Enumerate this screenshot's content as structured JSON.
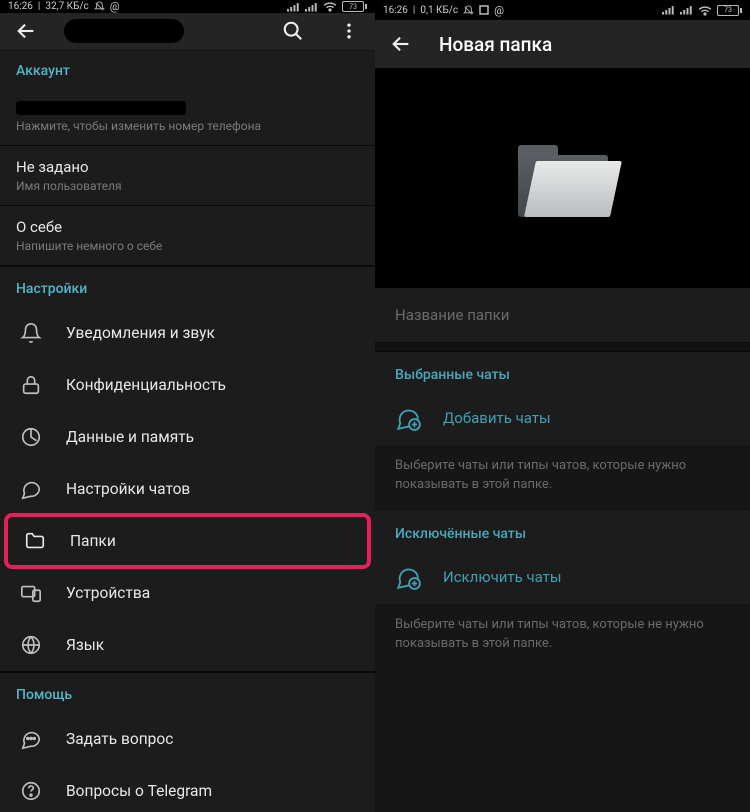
{
  "left": {
    "status": {
      "time": "16:26",
      "net": "32,7 КБ/с",
      "battery": "73"
    },
    "account": {
      "header": "Аккаунт",
      "phone_hint": "Нажмите, чтобы изменить номер телефона",
      "username_title": "Не задано",
      "username_sub": "Имя пользователя",
      "bio_title": "О себе",
      "bio_sub": "Напишите немного о себе"
    },
    "settings": {
      "header": "Настройки",
      "notifications": "Уведомления и звук",
      "privacy": "Конфиденциальность",
      "data": "Данные и память",
      "chat": "Настройки чатов",
      "folders": "Папки",
      "devices": "Устройства",
      "language": "Язык"
    },
    "help": {
      "header": "Помощь",
      "ask": "Задать вопрос",
      "faq": "Вопросы о Telegram"
    }
  },
  "right": {
    "status": {
      "time": "16:26",
      "net": "0,1 КБ/с",
      "battery": "73"
    },
    "title": "Новая папка",
    "name_placeholder": "Название папки",
    "included": {
      "header": "Выбранные чаты",
      "action": "Добавить чаты",
      "hint": "Выберите чаты или типы чатов, которые нужно показывать в этой папке."
    },
    "excluded": {
      "header": "Исключённые чаты",
      "action": "Исключить чаты",
      "hint": "Выберите чаты или типы чатов, которые не нужно показывать в этой папке."
    }
  }
}
